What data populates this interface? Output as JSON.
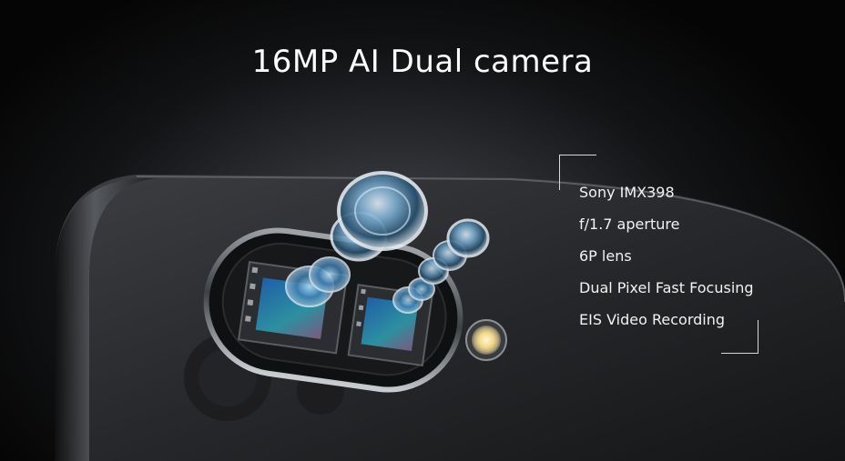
{
  "slide": {
    "title": "16MP AI Dual camera",
    "specs": [
      "Sony IMX398",
      "f/1.7 aperture",
      "6P lens",
      "Dual Pixel Fast Focusing",
      "EIS Video Recording"
    ]
  },
  "colors": {
    "background": "#000000",
    "text": "#ffffff",
    "sensor_blue": "#2f6fb3",
    "flash": "#f3e3a0"
  },
  "icons": [
    "camera-module-image",
    "lens-element",
    "flash-led"
  ]
}
